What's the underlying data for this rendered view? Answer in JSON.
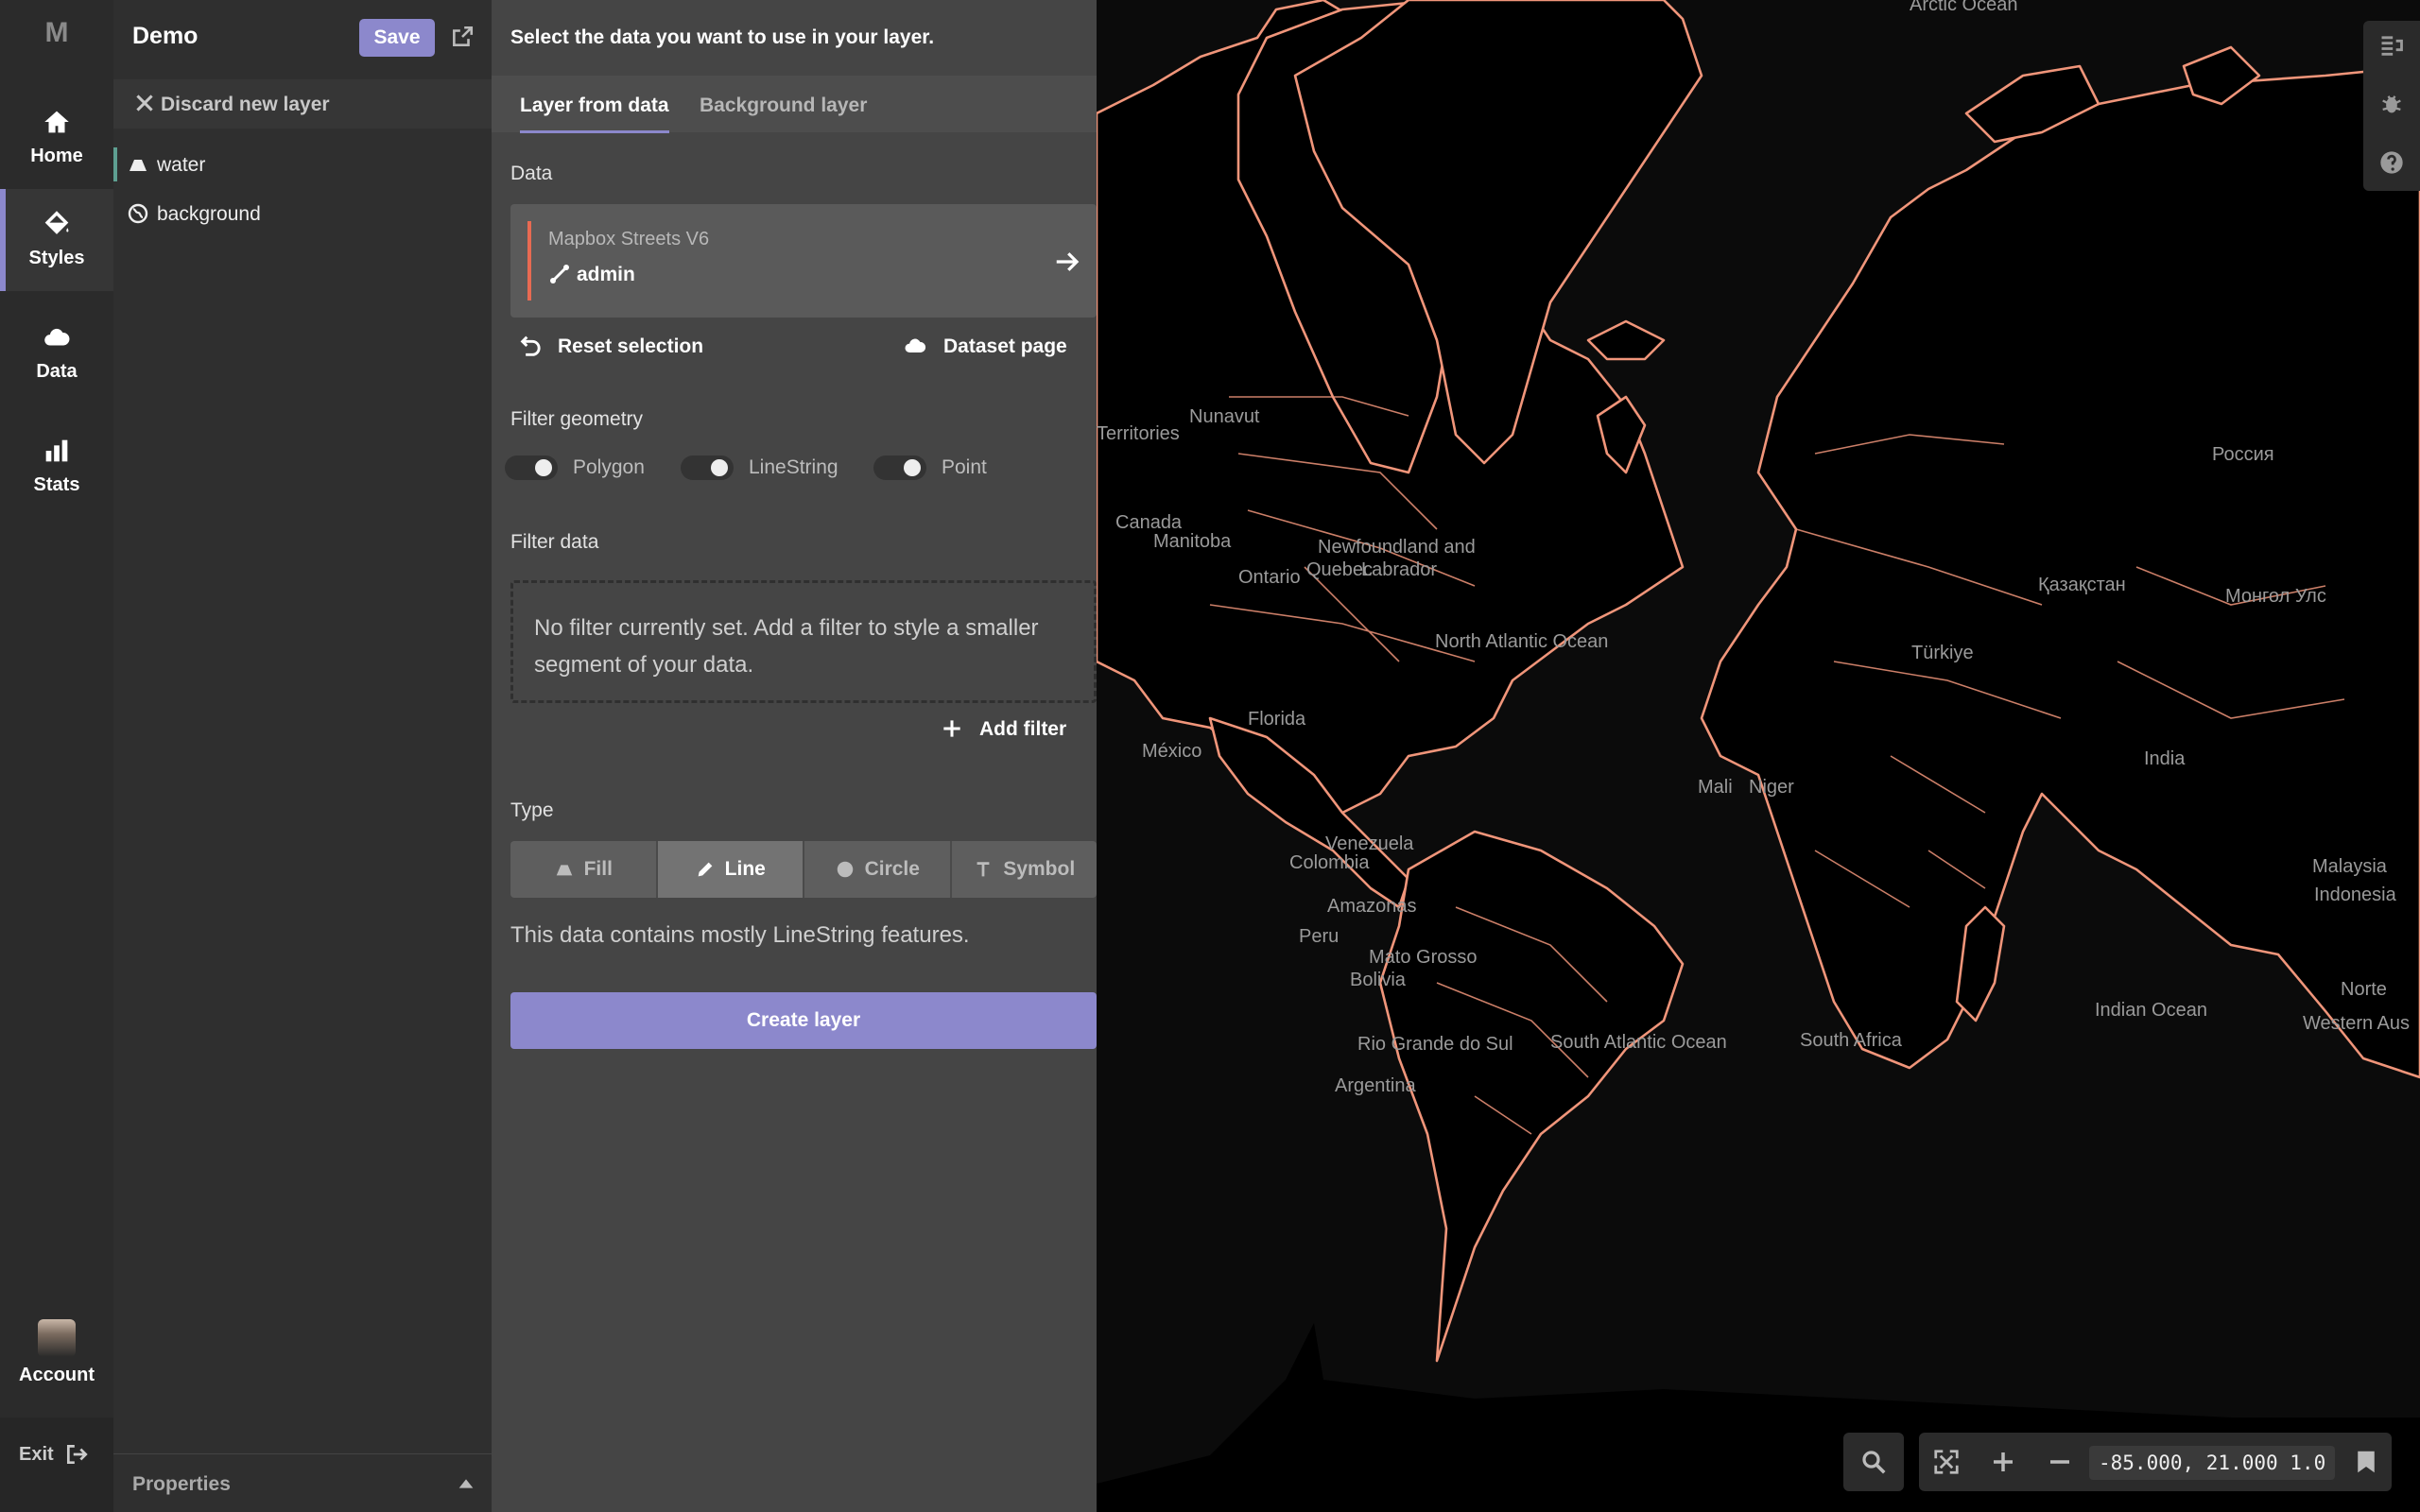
{
  "nav": {
    "logo": "M",
    "items": [
      {
        "label": "Home",
        "icon": "home-icon"
      },
      {
        "label": "Styles",
        "icon": "paint-bucket-icon"
      },
      {
        "label": "Data",
        "icon": "cloud-icon"
      },
      {
        "label": "Stats",
        "icon": "bar-chart-icon"
      }
    ],
    "account_label": "Account",
    "exit_label": "Exit"
  },
  "layers_panel": {
    "title": "Demo",
    "save_label": "Save",
    "discard_label": "Discard new layer",
    "layers": [
      {
        "name": "water",
        "icon": "fill-icon"
      },
      {
        "name": "background",
        "icon": "globe-icon"
      }
    ],
    "properties_label": "Properties"
  },
  "editor": {
    "heading": "Select the data you want to use in your layer.",
    "tabs": [
      "Layer from data",
      "Background layer"
    ],
    "data_label": "Data",
    "source_name": "Mapbox Streets V6",
    "source_layer": "admin",
    "reset_label": "Reset selection",
    "dataset_label": "Dataset page",
    "filter_geometry_label": "Filter geometry",
    "geometry_toggles": [
      "Polygon",
      "LineString",
      "Point"
    ],
    "filter_data_label": "Filter data",
    "filter_placeholder": "No filter currently set. Add a filter to style a smaller segment of your data.",
    "add_filter_label": "Add filter",
    "type_label": "Type",
    "types": [
      "Fill",
      "Line",
      "Circle",
      "Symbol"
    ],
    "active_type": "Line",
    "hint": "This data contains mostly LineString features.",
    "create_label": "Create layer"
  },
  "map": {
    "line_color": "#f0957a",
    "labels": [
      "Arctic Ocean",
      "Nunavut",
      "Territories",
      "Canada",
      "Manitoba",
      "Newfoundland and",
      "Quebec",
      "Labrador",
      "Ontario",
      "North Atlantic Ocean",
      "México",
      "Россия",
      "Қазақстан",
      "Монгол Улс",
      "India",
      "Malaysia",
      "Indonesia",
      "Indian Ocean",
      "Western Aus",
      "Mali",
      "Niger",
      "South Atlantic Ocean",
      "South Africa",
      "Venezuela",
      "Colombia",
      "Peru",
      "Rio Grande do Sul",
      "Argentina",
      "Mato Grosso",
      "Florida",
      "Türkiye",
      "Norte",
      "Amazonas",
      "Bolivia"
    ],
    "coords": "-85.000, 21.000 1.0"
  },
  "colors": {
    "accent": "#8c88cc",
    "rail_bg": "#2b2b2b",
    "panel_bg": "#2f2f2f",
    "editor_bg": "#454545",
    "map_bg": "#0b0b0b",
    "border_accent": "#e86a52"
  }
}
